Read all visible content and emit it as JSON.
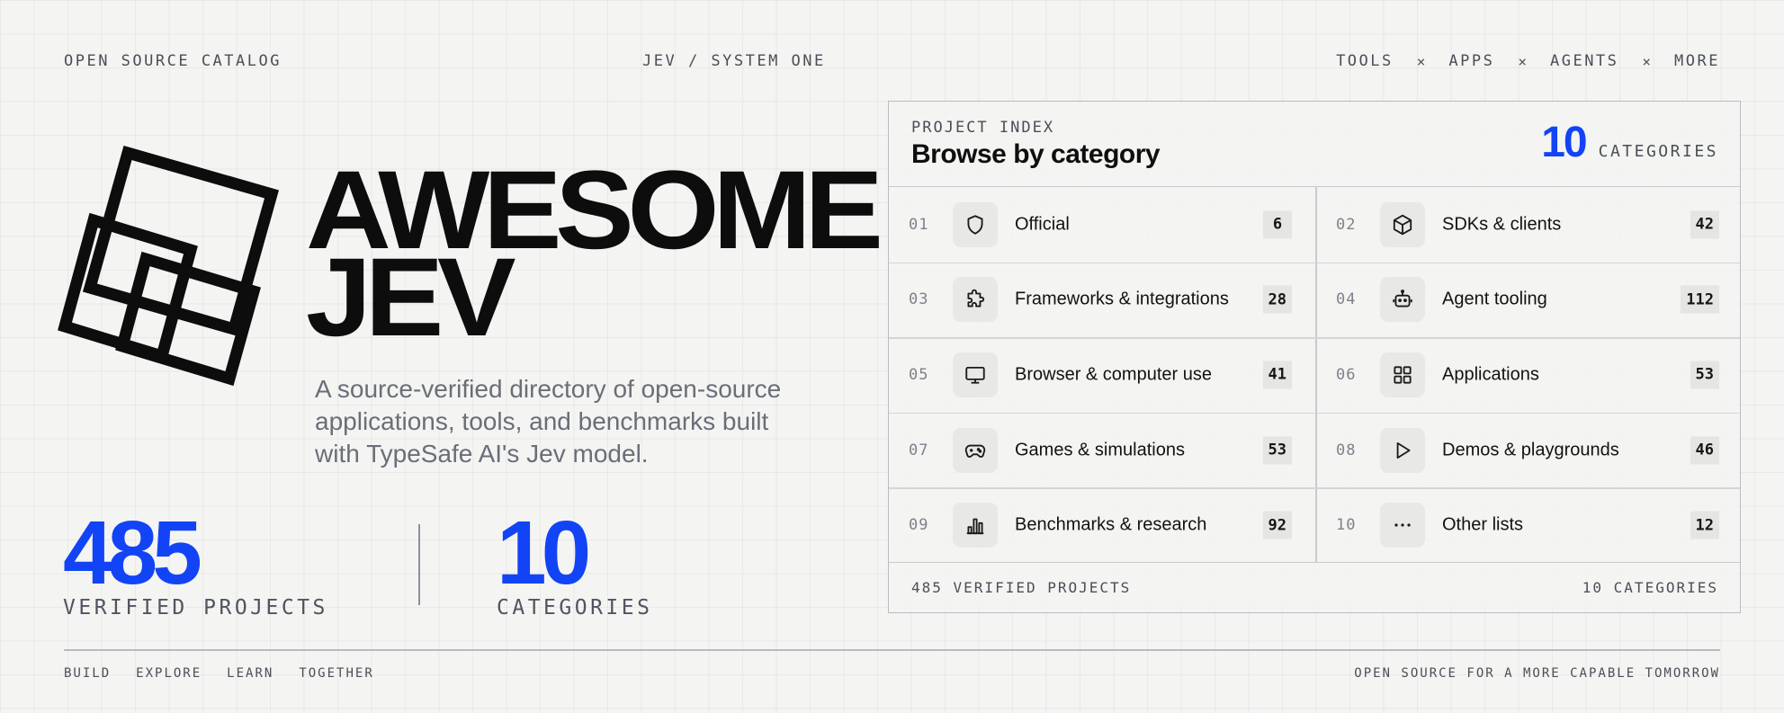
{
  "topbar": {
    "left": "OPEN SOURCE CATALOG",
    "center": "JEV / SYSTEM ONE",
    "nav": [
      "TOOLS",
      "APPS",
      "AGENTS",
      "MORE"
    ],
    "separator": "×"
  },
  "hero": {
    "title_line1": "AWESOME",
    "title_line2": "JEV",
    "subtitle": "A source-verified directory of open-source applications, tools, and benchmarks built with TypeSafe AI's Jev model."
  },
  "stats": {
    "projects_value": "485",
    "projects_label": "VERIFIED PROJECTS",
    "categories_value": "10",
    "categories_label": "CATEGORIES"
  },
  "card": {
    "kicker": "PROJECT INDEX",
    "title": "Browse by category",
    "count_value": "10",
    "count_label": "CATEGORIES",
    "categories": [
      {
        "index": "01",
        "icon": "shield-icon",
        "name": "Official",
        "count": "6"
      },
      {
        "index": "02",
        "icon": "cube-icon",
        "name": "SDKs & clients",
        "count": "42"
      },
      {
        "index": "03",
        "icon": "puzzle-icon",
        "name": "Frameworks & integrations",
        "count": "28"
      },
      {
        "index": "04",
        "icon": "robot-icon",
        "name": "Agent tooling",
        "count": "112"
      },
      {
        "index": "05",
        "icon": "monitor-icon",
        "name": "Browser & computer use",
        "count": "41"
      },
      {
        "index": "06",
        "icon": "grid-icon",
        "name": "Applications",
        "count": "53"
      },
      {
        "index": "07",
        "icon": "gamepad-icon",
        "name": "Games & simulations",
        "count": "53"
      },
      {
        "index": "08",
        "icon": "play-icon",
        "name": "Demos & playgrounds",
        "count": "46"
      },
      {
        "index": "09",
        "icon": "bar-chart-icon",
        "name": "Benchmarks & research",
        "count": "92"
      },
      {
        "index": "10",
        "icon": "more-dots-icon",
        "name": "Other lists",
        "count": "12"
      }
    ],
    "footer_left": "485 VERIFIED PROJECTS",
    "footer_right": "10 CATEGORIES"
  },
  "footer": {
    "left_items": [
      "BUILD",
      "EXPLORE",
      "LEARN",
      "TOGETHER"
    ],
    "right": "OPEN SOURCE FOR A MORE CAPABLE TOMORROW"
  },
  "colors": {
    "accent": "#1244f5",
    "background": "#f4f4f2",
    "text": "#111111",
    "muted": "#4a4f57"
  }
}
